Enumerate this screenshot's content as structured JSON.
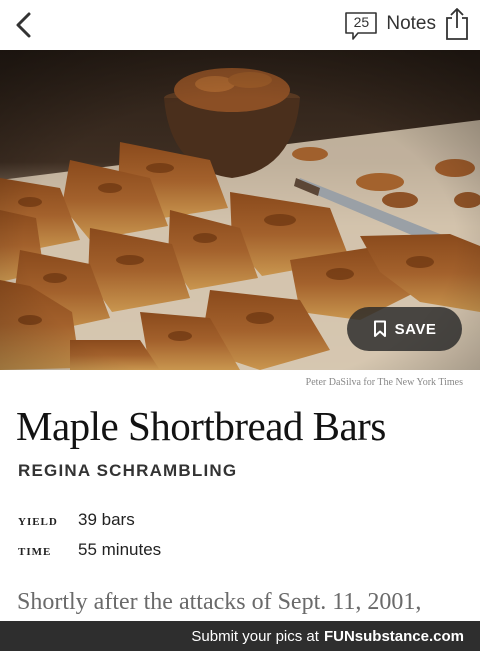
{
  "header": {
    "back_icon": "chevron-left-icon",
    "notes_count": "25",
    "notes_label": "Notes",
    "share_icon": "share-icon"
  },
  "hero": {
    "save_label": "SAVE",
    "save_icon": "bookmark-icon",
    "credit": "Peter DaSilva for The New York Times"
  },
  "recipe": {
    "title": "Maple Shortbread Bars",
    "author": "REGINA SCHRAMBLING",
    "yield_label": "yield",
    "yield_value": "39 bars",
    "time_label": "time",
    "time_value": "55 minutes",
    "intro": "Shortly after the attacks of Sept. 11, 2001,"
  },
  "footer": {
    "text": "Submit your pics at",
    "brand": "FUNsubstance.com"
  }
}
